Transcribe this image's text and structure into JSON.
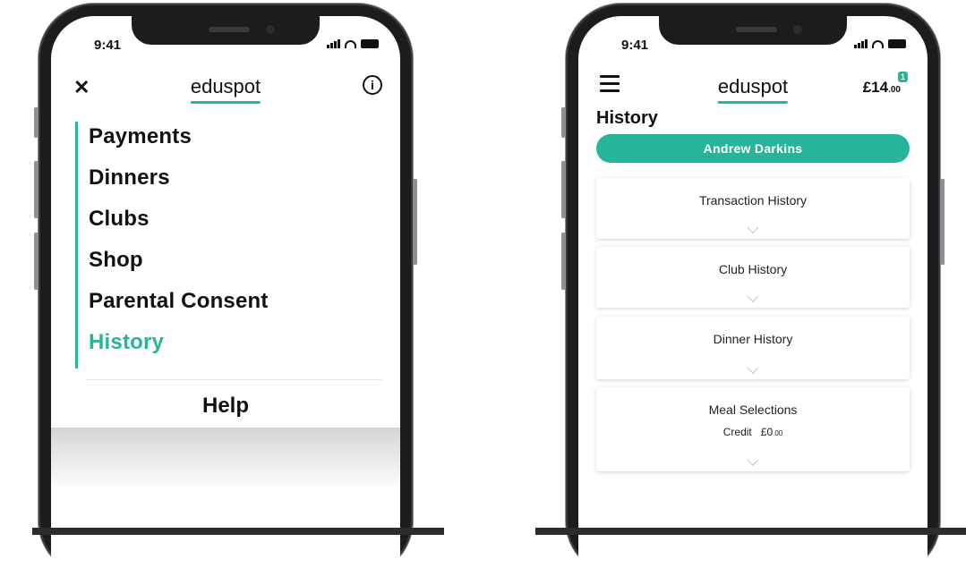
{
  "status_bar": {
    "time": "9:41"
  },
  "brand": {
    "logo_text": "eduspot",
    "accent_color": "#27b59a"
  },
  "menu_screen": {
    "close_icon": "close-icon",
    "info_icon": "info-icon",
    "items": [
      {
        "label": "Payments",
        "active": false
      },
      {
        "label": "Dinners",
        "active": false
      },
      {
        "label": "Clubs",
        "active": false
      },
      {
        "label": "Shop",
        "active": false
      },
      {
        "label": "Parental Consent",
        "active": false
      },
      {
        "label": "History",
        "active": true
      }
    ],
    "help_label": "Help"
  },
  "history_screen": {
    "balance_main": "£14",
    "balance_pence": ".00",
    "notification_count": "1",
    "page_title": "History",
    "child_name": "Andrew Darkins",
    "sections": [
      {
        "title": "Transaction History"
      },
      {
        "title": "Club History"
      },
      {
        "title": "Dinner History"
      },
      {
        "title": "Meal Selections",
        "credit_label": "Credit",
        "credit_value": "£0",
        "credit_pence": ".00"
      }
    ]
  }
}
